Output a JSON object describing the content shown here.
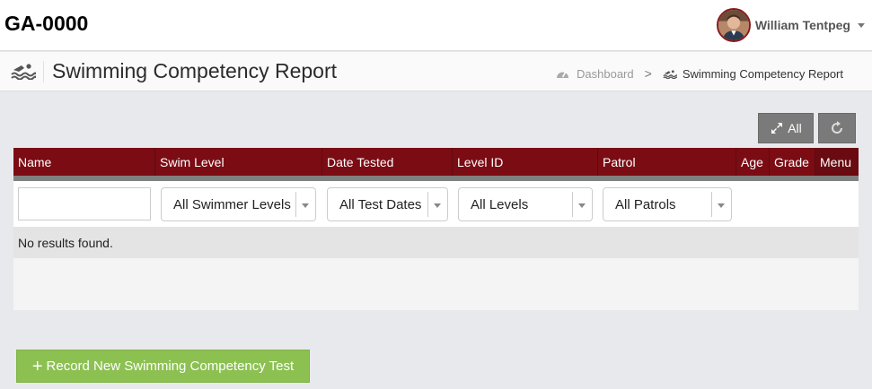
{
  "brand": "GA-0000",
  "user": {
    "name": "William Tentpeg",
    "avatar": "user-avatar-photo"
  },
  "page": {
    "title": "Swimming Competency Report",
    "icon": "swimmer-icon"
  },
  "breadcrumb": {
    "dashboard": "Dashboard",
    "separator": ">",
    "current": "Swimming Competency Report"
  },
  "toolbar": {
    "expand_all_label": "All",
    "expand_icon": "expand-arrows-icon",
    "refresh_icon": "refresh-icon"
  },
  "table": {
    "columns": [
      "Name",
      "Swim Level",
      "Date Tested",
      "Level ID",
      "Patrol",
      "Age",
      "Grade",
      "Menu"
    ],
    "filters": {
      "name_value": "",
      "swim_level": "All Swimmer Levels",
      "date_tested": "All Test Dates",
      "level_id": "All Levels",
      "patrol": "All Patrols"
    },
    "empty_message": "No results found."
  },
  "actions": {
    "record_new_label": "Record New Swimming Competency Test",
    "record_new_icon": "plus-icon"
  },
  "colors": {
    "header_bg": "#7b0c14",
    "record_button": "#8cc152",
    "toolbar_button": "#7a7a7a"
  }
}
